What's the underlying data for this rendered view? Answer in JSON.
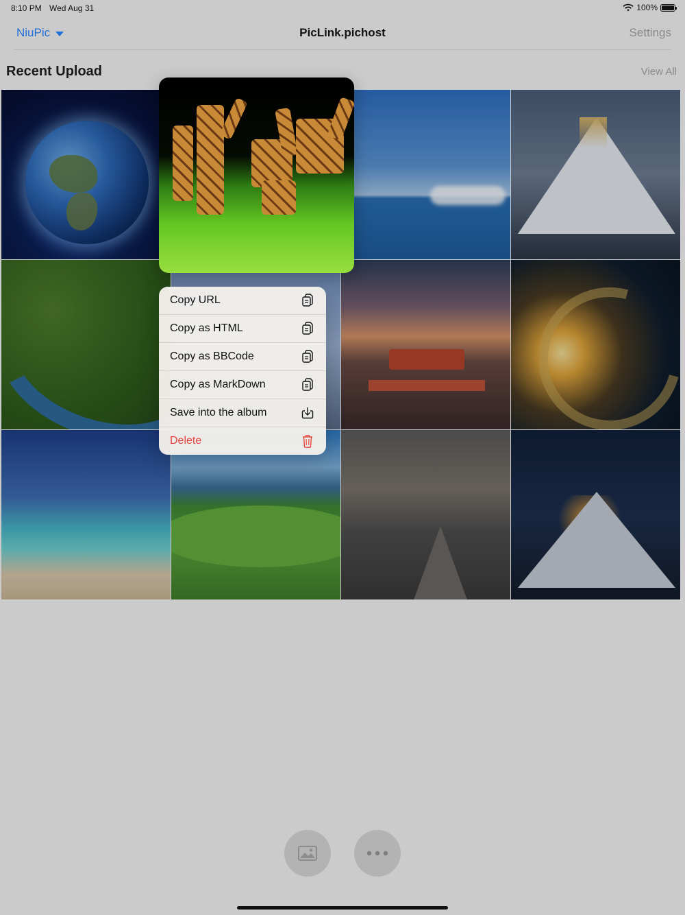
{
  "status_bar": {
    "time": "8:10 PM",
    "date": "Wed Aug 31",
    "battery": "100%"
  },
  "nav": {
    "source": "NiuPic",
    "title": "PicLink.pichost",
    "settings": "Settings"
  },
  "section": {
    "title": "Recent Upload",
    "view_all": "View All"
  },
  "grid": {
    "tiles": [
      "earth",
      "giraffes-selected",
      "ocean-horizon",
      "snow-mountain",
      "river-forest",
      "city-skyline",
      "palace-sunset",
      "wave-sunset",
      "tropical-beach",
      "green-hills",
      "wooden-bridge",
      "mountain-sunset"
    ]
  },
  "context_menu": {
    "items": [
      {
        "label": "Copy URL",
        "icon": "copy-icon"
      },
      {
        "label": "Copy as HTML",
        "icon": "copy-icon"
      },
      {
        "label": "Copy as BBCode",
        "icon": "copy-icon"
      },
      {
        "label": "Copy as MarkDown",
        "icon": "copy-icon"
      },
      {
        "label": "Save into the album",
        "icon": "download-icon"
      },
      {
        "label": "Delete",
        "icon": "trash-icon",
        "destructive": true
      }
    ]
  },
  "toolbar": {
    "buttons": [
      {
        "icon": "photo-icon"
      },
      {
        "icon": "more-icon"
      }
    ]
  },
  "colors": {
    "accent": "#1f6fd8",
    "destructive": "#e5443a",
    "background": "#cbcbcb"
  }
}
